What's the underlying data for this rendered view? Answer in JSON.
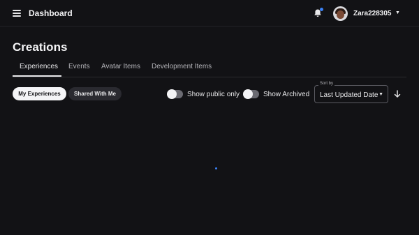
{
  "header": {
    "title": "Dashboard",
    "menu_icon": "hamburger-menu-icon",
    "notification_icon": "bell-icon",
    "notification_dot_color": "#3b82f6",
    "username": "Zara228305",
    "account_caret_icon": "caret-down-icon"
  },
  "page": {
    "title": "Creations"
  },
  "tabs": [
    {
      "label": "Experiences",
      "active": true
    },
    {
      "label": "Events",
      "active": false
    },
    {
      "label": "Avatar Items",
      "active": false
    },
    {
      "label": "Development Items",
      "active": false
    }
  ],
  "filters": {
    "my_experiences": "My Experiences",
    "shared_with_me": "Shared With Me",
    "show_public_only": {
      "label": "Show public only",
      "enabled": false
    },
    "show_archived": {
      "label": "Show Archived",
      "enabled": false
    }
  },
  "sort": {
    "legend": "Sort by",
    "value": "Last Updated Date",
    "direction_icon": "arrow-down-icon"
  },
  "colors": {
    "background": "#121215",
    "accent": "#3b82f6",
    "text": "#e8e8ea"
  }
}
